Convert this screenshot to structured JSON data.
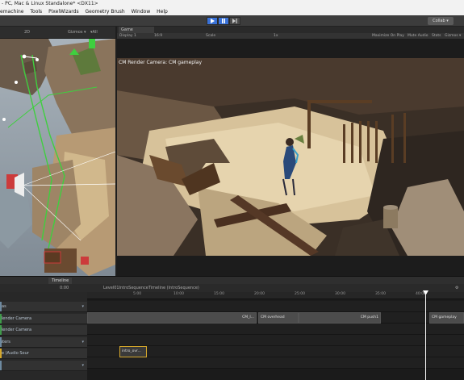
{
  "window": {
    "title": "- PC, Mac & Linux Standalone* <DX11>"
  },
  "menubar": {
    "items": [
      "emachine",
      "Tools",
      "PixelWizards",
      "Geometry Brush",
      "Window",
      "Help"
    ]
  },
  "toolbar": {
    "collab_label": "Collab ▾",
    "accent": "#3a72d8"
  },
  "scene": {
    "gizmo_label": "2D",
    "shading": "Gizmos ▾",
    "search": "▾All"
  },
  "game": {
    "tab_label": "Game",
    "display": "Display 1",
    "aspect": "16:9",
    "scale_label": "Scale",
    "scale_value": "1x",
    "maximize": "Maximize On Play",
    "mute": "Mute Audio",
    "stats": "Stats",
    "gizmos": "Gizmos ▾",
    "camera_label": "CM Render Camera: CM gameplay"
  },
  "timeline": {
    "tab_label": "Timeline",
    "frame": "0:00",
    "sequence_name": "Level01IntroSequenceTimeline (IntroSequence)",
    "ticks": [
      "0:00",
      "5:00",
      "10:00",
      "15:00",
      "20:00",
      "25:00",
      "30:00",
      "35:00",
      "40:00"
    ],
    "tracks": [
      {
        "label": "ras",
        "color": "#6e8aa0"
      },
      {
        "label": "Render Camera",
        "color": "#3f9a4a"
      },
      {
        "label": "Render Camera",
        "color": "#3f9a4a"
      },
      {
        "label": "uters",
        "color": "#6e8aa0"
      },
      {
        "label": "re (Audio Sour",
        "color": "#d4a72c"
      },
      {
        "label": "",
        "color": "#6e8aa0"
      }
    ],
    "clips": {
      "cm_intro": "CM_I...",
      "cm_overhead": "CM overhead",
      "cm_push": "CM push1",
      "cm_gameplay": "CM gameplay",
      "audio": "intro_ovr..."
    }
  }
}
